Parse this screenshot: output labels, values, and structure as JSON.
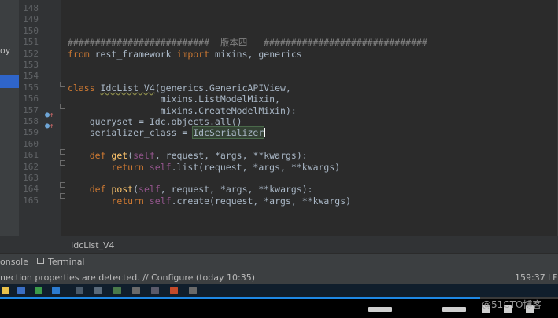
{
  "project_panel": {
    "label": "oy"
  },
  "editor": {
    "lines": [
      {
        "n": "148",
        "tokens": []
      },
      {
        "n": "149",
        "tokens": []
      },
      {
        "n": "150",
        "tokens": []
      },
      {
        "n": "151",
        "tokens": [
          {
            "t": "##########################  版本四   ##############################",
            "c": "cm"
          }
        ]
      },
      {
        "n": "152",
        "tokens": [
          {
            "t": "from",
            "c": "kw"
          },
          {
            "t": " rest_framework ",
            "c": ""
          },
          {
            "t": "import",
            "c": "kw"
          },
          {
            "t": " mixins, generics",
            "c": ""
          }
        ]
      },
      {
        "n": "153",
        "tokens": []
      },
      {
        "n": "154",
        "tokens": []
      },
      {
        "n": "155",
        "tokens": [
          {
            "t": "class ",
            "c": "kw"
          },
          {
            "t": "IdcList_V4",
            "c": "und"
          },
          {
            "t": "(generics.GenericAPIView,",
            "c": ""
          }
        ]
      },
      {
        "n": "156",
        "tokens": [
          {
            "t": "                 mixins.ListModelMixin,",
            "c": ""
          }
        ]
      },
      {
        "n": "157",
        "tokens": [
          {
            "t": "                 mixins.CreateModelMixin):",
            "c": ""
          }
        ]
      },
      {
        "n": "158",
        "tokens": [
          {
            "t": "    queryset = Idc.objects.all()",
            "c": ""
          }
        ]
      },
      {
        "n": "159",
        "tokens": [
          {
            "t": "    serializer_class = ",
            "c": ""
          },
          {
            "t": "IdcSerializer",
            "c": "hl"
          },
          {
            "t": "",
            "c": "caret"
          }
        ]
      },
      {
        "n": "160",
        "tokens": []
      },
      {
        "n": "161",
        "tokens": [
          {
            "t": "    ",
            "c": ""
          },
          {
            "t": "def ",
            "c": "kw"
          },
          {
            "t": "get",
            "c": "fn"
          },
          {
            "t": "(",
            "c": ""
          },
          {
            "t": "self",
            "c": "slf"
          },
          {
            "t": ", request, *args, **kwargs):",
            "c": ""
          }
        ]
      },
      {
        "n": "162",
        "tokens": [
          {
            "t": "        ",
            "c": ""
          },
          {
            "t": "return ",
            "c": "kw"
          },
          {
            "t": "self",
            "c": "slf"
          },
          {
            "t": ".list(request, *args, **kwargs)",
            "c": ""
          }
        ]
      },
      {
        "n": "163",
        "tokens": []
      },
      {
        "n": "164",
        "tokens": [
          {
            "t": "    ",
            "c": ""
          },
          {
            "t": "def ",
            "c": "kw"
          },
          {
            "t": "post",
            "c": "fn"
          },
          {
            "t": "(",
            "c": ""
          },
          {
            "t": "self",
            "c": "slf"
          },
          {
            "t": ", request, *args, **kwargs):",
            "c": ""
          }
        ]
      },
      {
        "n": "165",
        "tokens": [
          {
            "t": "        ",
            "c": ""
          },
          {
            "t": "return ",
            "c": "kw"
          },
          {
            "t": "self",
            "c": "slf"
          },
          {
            "t": ".create(request, *args, **kwargs)",
            "c": ""
          }
        ]
      }
    ]
  },
  "breadcrumb": "IdcList_V4",
  "tool_windows": {
    "console": "onsole",
    "terminal": "Terminal"
  },
  "status": {
    "message": "nection properties are detected. // Configure (today 10:35)",
    "position": "159:37",
    "line_sep": "LF"
  },
  "video": {
    "progress": 0.86,
    "watermark": "@51CTO博客"
  },
  "colors": {
    "accent": "#2f65ca",
    "progress": "#1e88e5",
    "editor_bg": "#2b2b2b",
    "keyword": "#cc7832"
  }
}
